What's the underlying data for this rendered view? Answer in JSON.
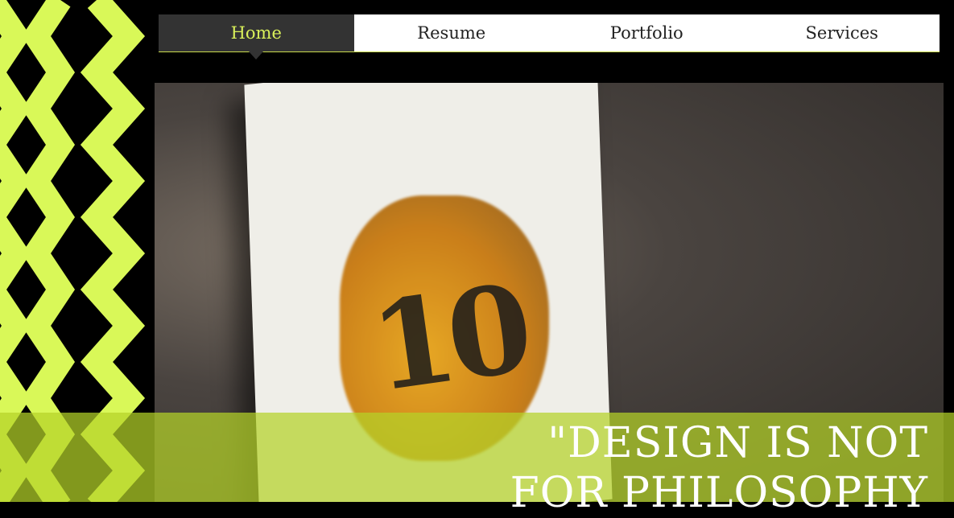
{
  "nav": {
    "items": [
      {
        "label": "Home",
        "active": true
      },
      {
        "label": "Resume",
        "active": false
      },
      {
        "label": "Portfolio",
        "active": false
      },
      {
        "label": "Services",
        "active": false
      }
    ]
  },
  "hero": {
    "quote_line1": "\"DESIGN IS NOT",
    "quote_line2": "FOR PHILOSOPHY"
  },
  "colors": {
    "accent": "#d9f05a",
    "background": "#000000",
    "nav_active_bg": "#333333"
  },
  "decor": {
    "left_pattern": "chevron-zigzag-pattern"
  }
}
